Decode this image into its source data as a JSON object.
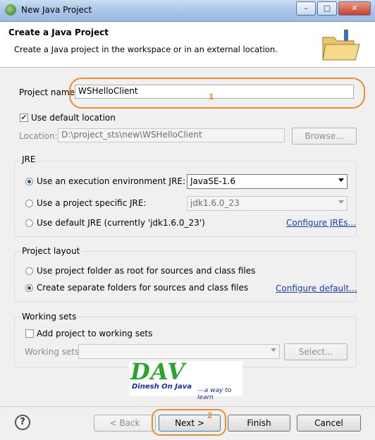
{
  "window": {
    "title": "New Java Project",
    "minimize": "–",
    "maximize": "□",
    "close": "✕"
  },
  "header": {
    "title": "Create a Java Project",
    "description": "Create a Java project in the workspace or in an external location."
  },
  "project_name": {
    "label": "Project name:",
    "value": "WSHelloClient",
    "annotation_number": "1"
  },
  "location": {
    "use_default_label": "Use default location",
    "use_default_checked": true,
    "label": "Location:",
    "value": "D:\\project_sts\\new\\WSHelloClient",
    "browse_label": "Browse..."
  },
  "jre": {
    "group_label": "JRE",
    "option_env_label": "Use an execution environment JRE:",
    "option_env_value": "JavaSE-1.6",
    "option_specific_label": "Use a project specific JRE:",
    "option_specific_value": "jdk1.6.0_23",
    "option_default_label": "Use default JRE (currently 'jdk1.6.0_23')",
    "configure_link": "Configure JREs...",
    "selected": "env"
  },
  "layout": {
    "group_label": "Project layout",
    "option_root_label": "Use project folder as root for sources and class files",
    "option_separate_label": "Create separate folders for sources and class files",
    "configure_link": "Configure default...",
    "selected": "separate"
  },
  "working_sets": {
    "group_label": "Working sets",
    "add_label": "Add project to working sets",
    "add_checked": false,
    "field_label": "Working sets:",
    "select_label": "Select..."
  },
  "watermark": {
    "logo_text": "DAV",
    "line1": "Dinesh On Java",
    "line2": "---a way to learn"
  },
  "footer": {
    "help_icon": "question-icon",
    "back_label": "< Back",
    "next_label": "Next >",
    "finish_label": "Finish",
    "cancel_label": "Cancel",
    "annotation_number": "2"
  }
}
